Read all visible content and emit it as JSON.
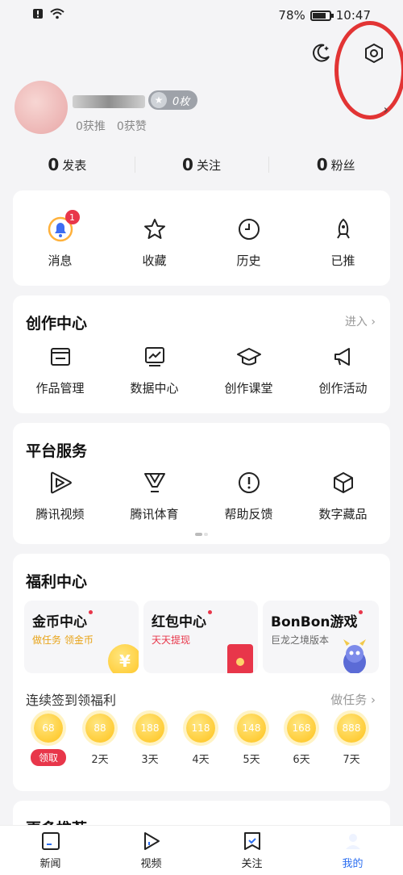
{
  "status": {
    "battery": "78%",
    "time": "10:47"
  },
  "profile": {
    "badge": "0枚",
    "stats": [
      "0获推",
      "0获赞"
    ]
  },
  "counts": [
    {
      "num": "0",
      "label": "发表"
    },
    {
      "num": "0",
      "label": "关注"
    },
    {
      "num": "0",
      "label": "粉丝"
    }
  ],
  "quick": {
    "items": [
      {
        "label": "消息",
        "badge": "1"
      },
      {
        "label": "收藏"
      },
      {
        "label": "历史"
      },
      {
        "label": "已推"
      }
    ]
  },
  "creation": {
    "title": "创作中心",
    "link": "进入 ›",
    "items": [
      {
        "label": "作品管理"
      },
      {
        "label": "数据中心"
      },
      {
        "label": "创作课堂"
      },
      {
        "label": "创作活动"
      }
    ]
  },
  "platform": {
    "title": "平台服务",
    "items": [
      {
        "label": "腾讯视频"
      },
      {
        "label": "腾讯体育"
      },
      {
        "label": "帮助反馈"
      },
      {
        "label": "数字藏品"
      }
    ]
  },
  "welfare": {
    "title": "福利中心",
    "tiles": [
      {
        "title": "金币中心",
        "sub": "做任务 领金币"
      },
      {
        "title": "红包中心",
        "sub": "天天提现"
      },
      {
        "title": "BonBon游戏",
        "sub": "巨龙之境版本"
      }
    ],
    "signin_title": "连续签到领福利",
    "signin_link": "做任务 ›",
    "days": [
      {
        "coins": "68",
        "label": "领取"
      },
      {
        "coins": "88",
        "label": "2天"
      },
      {
        "coins": "188",
        "label": "3天"
      },
      {
        "coins": "118",
        "label": "4天"
      },
      {
        "coins": "148",
        "label": "5天"
      },
      {
        "coins": "168",
        "label": "6天"
      },
      {
        "coins": "888",
        "label": "7天"
      }
    ]
  },
  "more": {
    "title": "更多推荐"
  },
  "nav": [
    {
      "label": "新闻"
    },
    {
      "label": "视频"
    },
    {
      "label": "关注"
    },
    {
      "label": "我的"
    }
  ],
  "colors": {
    "accent": "#2b6ef0",
    "badge_red": "#e8364a",
    "coin": "#ffc21a",
    "annotation_ring": "#e23434"
  }
}
